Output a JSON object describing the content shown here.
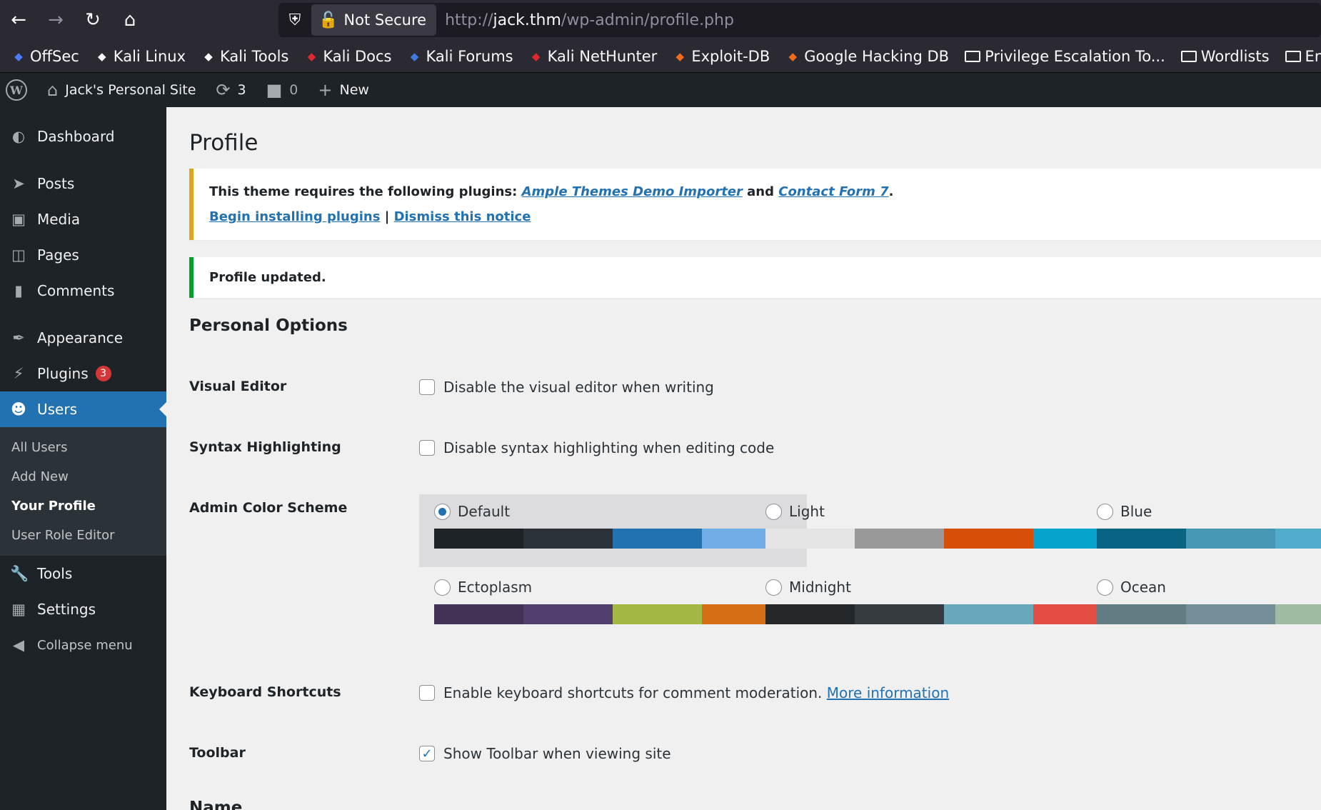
{
  "browser": {
    "security_label": "Not Secure",
    "url_prefix": "http://",
    "url_host": "jack.thm",
    "url_path": "/wp-admin/profile.php",
    "bookmarks": [
      {
        "label": "OffSec",
        "icon": "offsec-icon",
        "color": "#4a7dff"
      },
      {
        "label": "Kali Linux",
        "icon": "kali-icon",
        "color": "#fbfbfe"
      },
      {
        "label": "Kali Tools",
        "icon": "kali-icon",
        "color": "#fbfbfe"
      },
      {
        "label": "Kali Docs",
        "icon": "kali-docs-icon",
        "color": "#e0282e"
      },
      {
        "label": "Kali Forums",
        "icon": "kali-forums-icon",
        "color": "#3a7dde"
      },
      {
        "label": "Kali NetHunter",
        "icon": "nethunter-icon",
        "color": "#e0282e"
      },
      {
        "label": "Exploit-DB",
        "icon": "exploitdb-icon",
        "color": "#f26b1d"
      },
      {
        "label": "Google Hacking DB",
        "icon": "ghdb-icon",
        "color": "#f26b1d"
      },
      {
        "label": "Privilege Escalation To...",
        "icon": "folder-icon"
      },
      {
        "label": "Wordlists",
        "icon": "folder-icon"
      },
      {
        "label": "Encode and D",
        "icon": "folder-icon"
      }
    ]
  },
  "adminbar": {
    "site_name": "Jack's Personal Site",
    "updates_count": "3",
    "comments_count": "0",
    "new_label": "New"
  },
  "sidebar": {
    "items": [
      {
        "label": "Dashboard",
        "icon": "dashboard-icon"
      },
      {
        "label": "Posts",
        "icon": "pin-icon"
      },
      {
        "label": "Media",
        "icon": "media-icon"
      },
      {
        "label": "Pages",
        "icon": "pages-icon"
      },
      {
        "label": "Comments",
        "icon": "comment-icon"
      },
      {
        "label": "Appearance",
        "icon": "brush-icon"
      },
      {
        "label": "Plugins",
        "icon": "plugin-icon",
        "badge": "3"
      },
      {
        "label": "Users",
        "icon": "user-icon",
        "active": true
      },
      {
        "label": "Tools",
        "icon": "wrench-icon"
      },
      {
        "label": "Settings",
        "icon": "settings-icon"
      },
      {
        "label": "Collapse menu",
        "icon": "collapse-icon"
      }
    ],
    "users_submenu": [
      "All Users",
      "Add New",
      "Your Profile",
      "User Role Editor"
    ]
  },
  "page": {
    "title": "Profile",
    "notice": {
      "prefix": "This theme requires the following plugins: ",
      "plugin1": "Ample Themes Demo Importer",
      "and": " and ",
      "plugin2": "Contact Form 7",
      "period": ".",
      "install_link": "Begin installing plugins",
      "separator": " | ",
      "dismiss_link": "Dismiss this notice"
    },
    "success_notice": "Profile updated.",
    "section_title": "Personal Options",
    "visual_editor": {
      "label": "Visual Editor",
      "text": "Disable the visual editor when writing",
      "checked": false
    },
    "syntax": {
      "label": "Syntax Highlighting",
      "text": "Disable syntax highlighting when editing code",
      "checked": false
    },
    "color_scheme": {
      "label": "Admin Color Scheme",
      "schemes": [
        {
          "name": "Default",
          "selected": true,
          "colors": [
            "#1d2327",
            "#2c3338",
            "#2271b1",
            "#72aee6"
          ]
        },
        {
          "name": "Light",
          "selected": false,
          "colors": [
            "#e5e5e5",
            "#999999",
            "#d64e07",
            "#04a4cc"
          ]
        },
        {
          "name": "Blue",
          "selected": false,
          "colors": [
            "#096484",
            "#4796b3",
            "#52accc",
            "#74b6ce"
          ]
        },
        {
          "name": "Ectoplasm",
          "selected": false,
          "colors": [
            "#413256",
            "#523f6d",
            "#a3b745",
            "#d46f15"
          ]
        },
        {
          "name": "Midnight",
          "selected": false,
          "colors": [
            "#25282b",
            "#363b3f",
            "#69a8bb",
            "#e14d43"
          ]
        },
        {
          "name": "Ocean",
          "selected": false,
          "colors": [
            "#627c83",
            "#738e96",
            "#9ebaa0",
            "#aa9d88"
          ]
        }
      ]
    },
    "keyboard": {
      "label": "Keyboard Shortcuts",
      "text": "Enable keyboard shortcuts for comment moderation. ",
      "link": "More information",
      "checked": false
    },
    "toolbar": {
      "label": "Toolbar",
      "text": "Show Toolbar when viewing site",
      "checked": true
    },
    "next_section": "Name"
  }
}
